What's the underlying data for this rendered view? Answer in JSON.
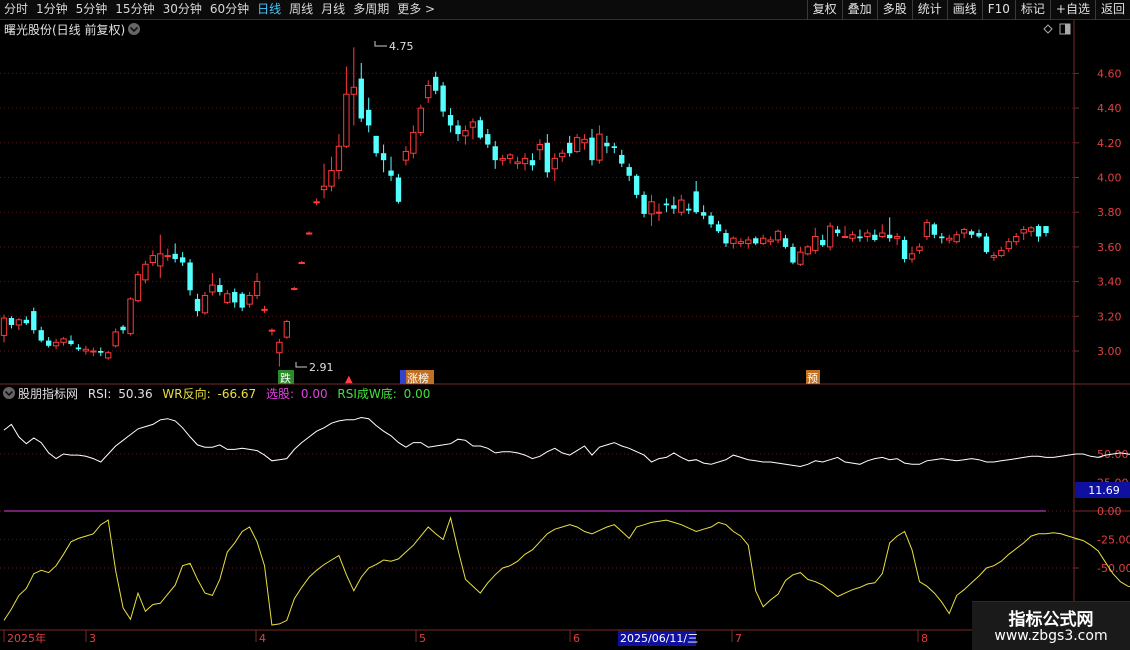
{
  "toolbar": {
    "period_tabs": [
      "分时",
      "1分钟",
      "5分钟",
      "15分钟",
      "30分钟",
      "60分钟",
      "日线",
      "周线",
      "月线",
      "多周期",
      "更多 >"
    ],
    "active_tab": "日线",
    "tools": [
      "复权",
      "叠加",
      "多股",
      "统计",
      "画线",
      "F10",
      "标记",
      "+自选",
      "返回"
    ]
  },
  "main_chart": {
    "title": "曙光股份(日线 前复权)",
    "y_ticks": [
      "4.60",
      "4.40",
      "4.20",
      "4.00",
      "3.80",
      "3.60",
      "3.40",
      "3.20",
      "3.00"
    ],
    "high_label": "4.75",
    "low_label": "2.91",
    "markers": [
      {
        "text": "跌",
        "color": "#2a8a2a"
      },
      {
        "text": "▲",
        "color": "#ff4040"
      },
      {
        "text": "　　",
        "color": "#3344cc"
      },
      {
        "text": "涨榜",
        "color": "#c07020"
      },
      {
        "text": "预",
        "color": "#c07020"
      }
    ]
  },
  "indicator": {
    "name": "股朋指标网",
    "rsi_label": "RSI:",
    "rsi_value": "50.36",
    "wr_label": "WR反向:",
    "wr_value": "-66.67",
    "pick_label": "选股:",
    "pick_value": "0.00",
    "rsiw_label": "RSI成W底:",
    "rsiw_value": "0.00",
    "y_ticks": [
      "50.00",
      "0.00",
      "-25.00",
      "-50.00"
    ],
    "y_extra": "25.00",
    "cursor_value": "11.69",
    "colors": {
      "rsi": "#ffffff",
      "wr": "#e8e040",
      "pick": "#e040e0",
      "rsiw": "#40e040"
    }
  },
  "x_axis": {
    "labels": [
      "2025年",
      "3",
      "4",
      "5",
      "6",
      "2025/06/11/三",
      "7",
      "8"
    ],
    "highlight": "2025/06/11/三"
  },
  "watermark": {
    "cn": "指标公式网",
    "url": "www.zbgs3.com"
  },
  "chart_data": {
    "type": "candlestick",
    "title": "曙光股份(日线 前复权)",
    "ylim": [
      2.85,
      4.85
    ],
    "up_color": "#ff3a3a",
    "down_color": "#54ffff",
    "candles": [
      [
        3.09,
        3.21,
        3.05,
        3.19
      ],
      [
        3.19,
        3.2,
        3.13,
        3.15
      ],
      [
        3.15,
        3.19,
        3.12,
        3.18
      ],
      [
        3.18,
        3.2,
        3.15,
        3.16
      ],
      [
        3.23,
        3.25,
        3.1,
        3.12
      ],
      [
        3.12,
        3.14,
        3.05,
        3.06
      ],
      [
        3.06,
        3.08,
        3.02,
        3.03
      ],
      [
        3.03,
        3.07,
        3.01,
        3.05
      ],
      [
        3.05,
        3.08,
        3.03,
        3.07
      ],
      [
        3.06,
        3.09,
        3.03,
        3.04
      ],
      [
        3.02,
        3.04,
        3.0,
        3.01
      ],
      [
        3.0,
        3.03,
        2.98,
        3.01
      ],
      [
        3.0,
        3.02,
        2.97,
        3.0
      ],
      [
        3.0,
        3.02,
        2.97,
        2.99
      ],
      [
        2.96,
        3.0,
        2.95,
        2.99
      ],
      [
        3.03,
        3.13,
        3.02,
        3.11
      ],
      [
        3.14,
        3.15,
        3.1,
        3.12
      ],
      [
        3.1,
        3.31,
        3.09,
        3.3
      ],
      [
        3.29,
        3.46,
        3.28,
        3.44
      ],
      [
        3.41,
        3.52,
        3.39,
        3.5
      ],
      [
        3.51,
        3.58,
        3.49,
        3.55
      ],
      [
        3.49,
        3.67,
        3.42,
        3.56
      ],
      [
        3.55,
        3.59,
        3.52,
        3.55
      ],
      [
        3.56,
        3.62,
        3.51,
        3.53
      ],
      [
        3.54,
        3.57,
        3.49,
        3.51
      ],
      [
        3.51,
        3.53,
        3.32,
        3.35
      ],
      [
        3.3,
        3.33,
        3.2,
        3.23
      ],
      [
        3.22,
        3.34,
        3.21,
        3.32
      ],
      [
        3.34,
        3.45,
        3.32,
        3.38
      ],
      [
        3.38,
        3.42,
        3.32,
        3.34
      ],
      [
        3.28,
        3.35,
        3.27,
        3.33
      ],
      [
        3.34,
        3.36,
        3.25,
        3.28
      ],
      [
        3.33,
        3.34,
        3.23,
        3.25
      ],
      [
        3.27,
        3.34,
        3.25,
        3.32
      ],
      [
        3.32,
        3.45,
        3.3,
        3.4
      ],
      [
        3.24,
        3.26,
        3.22,
        3.24
      ],
      [
        3.12,
        3.13,
        3.09,
        3.12
      ],
      [
        2.99,
        3.07,
        2.91,
        3.05
      ],
      [
        3.08,
        3.18,
        3.07,
        3.17
      ],
      [
        3.36,
        3.37,
        3.35,
        3.36
      ],
      [
        3.51,
        3.52,
        3.5,
        3.51
      ],
      [
        3.68,
        3.69,
        3.67,
        3.68
      ],
      [
        3.86,
        3.88,
        3.84,
        3.86
      ],
      [
        3.93,
        4.08,
        3.88,
        3.95
      ],
      [
        3.95,
        4.12,
        3.92,
        4.04
      ],
      [
        4.04,
        4.25,
        3.99,
        4.18
      ],
      [
        4.18,
        4.64,
        4.17,
        4.48
      ],
      [
        4.48,
        4.75,
        4.3,
        4.52
      ],
      [
        4.57,
        4.66,
        4.32,
        4.34
      ],
      [
        4.39,
        4.46,
        4.26,
        4.3
      ],
      [
        4.24,
        4.24,
        4.12,
        4.14
      ],
      [
        4.14,
        4.19,
        4.03,
        4.1
      ],
      [
        4.04,
        4.12,
        3.98,
        4.01
      ],
      [
        4.0,
        4.02,
        3.85,
        3.86
      ],
      [
        4.1,
        4.18,
        4.07,
        4.15
      ],
      [
        4.14,
        4.3,
        4.11,
        4.26
      ],
      [
        4.26,
        4.42,
        4.24,
        4.4
      ],
      [
        4.46,
        4.56,
        4.43,
        4.53
      ],
      [
        4.58,
        4.61,
        4.48,
        4.5
      ],
      [
        4.53,
        4.55,
        4.35,
        4.38
      ],
      [
        4.36,
        4.4,
        4.26,
        4.3
      ],
      [
        4.3,
        4.33,
        4.21,
        4.25
      ],
      [
        4.24,
        4.3,
        4.19,
        4.27
      ],
      [
        4.29,
        4.34,
        4.22,
        4.32
      ],
      [
        4.33,
        4.35,
        4.22,
        4.23
      ],
      [
        4.25,
        4.28,
        4.17,
        4.19
      ],
      [
        4.18,
        4.21,
        4.05,
        4.1
      ],
      [
        4.1,
        4.13,
        4.07,
        4.11
      ],
      [
        4.11,
        4.14,
        4.08,
        4.13
      ],
      [
        4.08,
        4.12,
        4.05,
        4.09
      ],
      [
        4.08,
        4.14,
        4.04,
        4.11
      ],
      [
        4.1,
        4.14,
        4.04,
        4.07
      ],
      [
        4.16,
        4.22,
        4.1,
        4.19
      ],
      [
        4.2,
        4.25,
        4.0,
        4.03
      ],
      [
        4.05,
        4.14,
        3.98,
        4.11
      ],
      [
        4.12,
        4.16,
        4.09,
        4.14
      ],
      [
        4.2,
        4.24,
        4.12,
        4.14
      ],
      [
        4.15,
        4.25,
        4.14,
        4.23
      ],
      [
        4.2,
        4.25,
        4.16,
        4.22
      ],
      [
        4.23,
        4.28,
        4.07,
        4.1
      ],
      [
        4.1,
        4.3,
        4.08,
        4.25
      ],
      [
        4.2,
        4.24,
        4.14,
        4.18
      ],
      [
        4.18,
        4.2,
        4.14,
        4.17
      ],
      [
        4.13,
        4.16,
        4.06,
        4.08
      ],
      [
        4.06,
        4.08,
        3.98,
        4.01
      ],
      [
        4.01,
        4.02,
        3.88,
        3.9
      ],
      [
        3.9,
        3.92,
        3.77,
        3.79
      ],
      [
        3.79,
        3.9,
        3.72,
        3.86
      ],
      [
        3.8,
        3.85,
        3.75,
        3.8
      ],
      [
        3.85,
        3.88,
        3.8,
        3.84
      ],
      [
        3.84,
        3.89,
        3.79,
        3.82
      ],
      [
        3.8,
        3.9,
        3.78,
        3.87
      ],
      [
        3.82,
        3.85,
        3.79,
        3.81
      ],
      [
        3.92,
        3.98,
        3.79,
        3.8
      ],
      [
        3.8,
        3.84,
        3.76,
        3.78
      ],
      [
        3.78,
        3.8,
        3.71,
        3.73
      ],
      [
        3.73,
        3.75,
        3.68,
        3.69
      ],
      [
        3.68,
        3.7,
        3.6,
        3.62
      ],
      [
        3.62,
        3.66,
        3.59,
        3.65
      ],
      [
        3.62,
        3.65,
        3.6,
        3.63
      ],
      [
        3.62,
        3.66,
        3.59,
        3.64
      ],
      [
        3.65,
        3.66,
        3.61,
        3.62
      ],
      [
        3.62,
        3.67,
        3.61,
        3.65
      ],
      [
        3.63,
        3.66,
        3.61,
        3.64
      ],
      [
        3.64,
        3.7,
        3.62,
        3.69
      ],
      [
        3.65,
        3.67,
        3.59,
        3.6
      ],
      [
        3.6,
        3.62,
        3.5,
        3.51
      ],
      [
        3.5,
        3.6,
        3.49,
        3.57
      ],
      [
        3.56,
        3.61,
        3.55,
        3.6
      ],
      [
        3.58,
        3.71,
        3.56,
        3.66
      ],
      [
        3.64,
        3.67,
        3.6,
        3.61
      ],
      [
        3.6,
        3.74,
        3.58,
        3.72
      ],
      [
        3.7,
        3.72,
        3.66,
        3.68
      ],
      [
        3.66,
        3.72,
        3.65,
        3.66
      ],
      [
        3.65,
        3.69,
        3.63,
        3.67
      ],
      [
        3.66,
        3.7,
        3.63,
        3.65
      ],
      [
        3.66,
        3.7,
        3.63,
        3.68
      ],
      [
        3.67,
        3.7,
        3.63,
        3.64
      ],
      [
        3.66,
        3.73,
        3.65,
        3.68
      ],
      [
        3.67,
        3.77,
        3.63,
        3.65
      ],
      [
        3.65,
        3.68,
        3.61,
        3.66
      ],
      [
        3.64,
        3.66,
        3.51,
        3.53
      ],
      [
        3.53,
        3.6,
        3.51,
        3.56
      ],
      [
        3.58,
        3.62,
        3.56,
        3.6
      ],
      [
        3.66,
        3.76,
        3.64,
        3.74
      ],
      [
        3.73,
        3.74,
        3.65,
        3.67
      ],
      [
        3.66,
        3.68,
        3.62,
        3.65
      ],
      [
        3.64,
        3.67,
        3.62,
        3.65
      ],
      [
        3.63,
        3.69,
        3.62,
        3.67
      ],
      [
        3.68,
        3.71,
        3.65,
        3.7
      ],
      [
        3.69,
        3.7,
        3.65,
        3.67
      ],
      [
        3.68,
        3.7,
        3.65,
        3.66
      ],
      [
        3.66,
        3.68,
        3.56,
        3.57
      ],
      [
        3.54,
        3.57,
        3.52,
        3.55
      ],
      [
        3.55,
        3.6,
        3.54,
        3.58
      ],
      [
        3.59,
        3.65,
        3.57,
        3.63
      ],
      [
        3.63,
        3.68,
        3.61,
        3.66
      ],
      [
        3.68,
        3.72,
        3.64,
        3.7
      ],
      [
        3.69,
        3.72,
        3.66,
        3.71
      ],
      [
        3.72,
        3.73,
        3.63,
        3.66
      ],
      [
        3.72,
        3.72,
        3.66,
        3.68
      ]
    ],
    "rsi": [
      71,
      76,
      65,
      59,
      64,
      60,
      51,
      46,
      50,
      49,
      49,
      48,
      46,
      43,
      50,
      57,
      62,
      67,
      72,
      74,
      76,
      80,
      81,
      79,
      73,
      65,
      58,
      56,
      56,
      58,
      54,
      54,
      55,
      54,
      53,
      49,
      44,
      45,
      46,
      54,
      60,
      65,
      70,
      73,
      77,
      79,
      80,
      80,
      82,
      81,
      75,
      70,
      66,
      60,
      56,
      60,
      60,
      56,
      57,
      58,
      59,
      63,
      62,
      57,
      57,
      55,
      51,
      52,
      52,
      51,
      49,
      46,
      48,
      52,
      55,
      51,
      49,
      53,
      57,
      49,
      56,
      58,
      60,
      57,
      55,
      52,
      49,
      43,
      46,
      47,
      51,
      47,
      44,
      45,
      42,
      41,
      43,
      45,
      49,
      47,
      45,
      44,
      43,
      43,
      42,
      41,
      40,
      39,
      41,
      44,
      43,
      45,
      47,
      43,
      42,
      41,
      44,
      46,
      47,
      45,
      46,
      42,
      41,
      41,
      44,
      45,
      46,
      45,
      44,
      45,
      46,
      45,
      43,
      43,
      44,
      45,
      46,
      47,
      48,
      48,
      47,
      47,
      48,
      49,
      50,
      50,
      48,
      47,
      49,
      50,
      51,
      50,
      49,
      49,
      48,
      47,
      45,
      43,
      50
    ],
    "wr": [
      -96,
      -86,
      -74,
      -68,
      -55,
      -52,
      -54,
      -48,
      -38,
      -27,
      -24,
      -22,
      -20,
      -12,
      -8,
      -52,
      -85,
      -95,
      -72,
      -88,
      -82,
      -81,
      -73,
      -65,
      -48,
      -46,
      -60,
      -72,
      -74,
      -60,
      -36,
      -28,
      -18,
      -14,
      -27,
      -48,
      -100,
      -99,
      -96,
      -77,
      -67,
      -58,
      -52,
      -47,
      -43,
      -39,
      -56,
      -70,
      -58,
      -50,
      -47,
      -43,
      -44,
      -42,
      -36,
      -30,
      -22,
      -14,
      -20,
      -25,
      -6,
      -34,
      -60,
      -66,
      -72,
      -63,
      -56,
      -50,
      -48,
      -44,
      -38,
      -34,
      -27,
      -20,
      -16,
      -14,
      -12,
      -14,
      -18,
      -20,
      -17,
      -14,
      -12,
      -18,
      -24,
      -14,
      -12,
      -10,
      -9,
      -8,
      -10,
      -12,
      -15,
      -18,
      -16,
      -14,
      -10,
      -12,
      -18,
      -22,
      -30,
      -70,
      -84,
      -78,
      -73,
      -61,
      -56,
      -54,
      -60,
      -62,
      -65,
      -70,
      -75,
      -72,
      -69,
      -67,
      -64,
      -63,
      -55,
      -28,
      -22,
      -18,
      -34,
      -62,
      -66,
      -72,
      -80,
      -90,
      -74,
      -69,
      -63,
      -57,
      -50,
      -48,
      -44,
      -38,
      -33,
      -28,
      -22,
      -20,
      -20,
      -19,
      -20,
      -22,
      -24,
      -26,
      -30,
      -35,
      -45,
      -55,
      -62,
      -66,
      -67,
      -67,
      -66,
      -67,
      -67,
      -67
    ]
  }
}
